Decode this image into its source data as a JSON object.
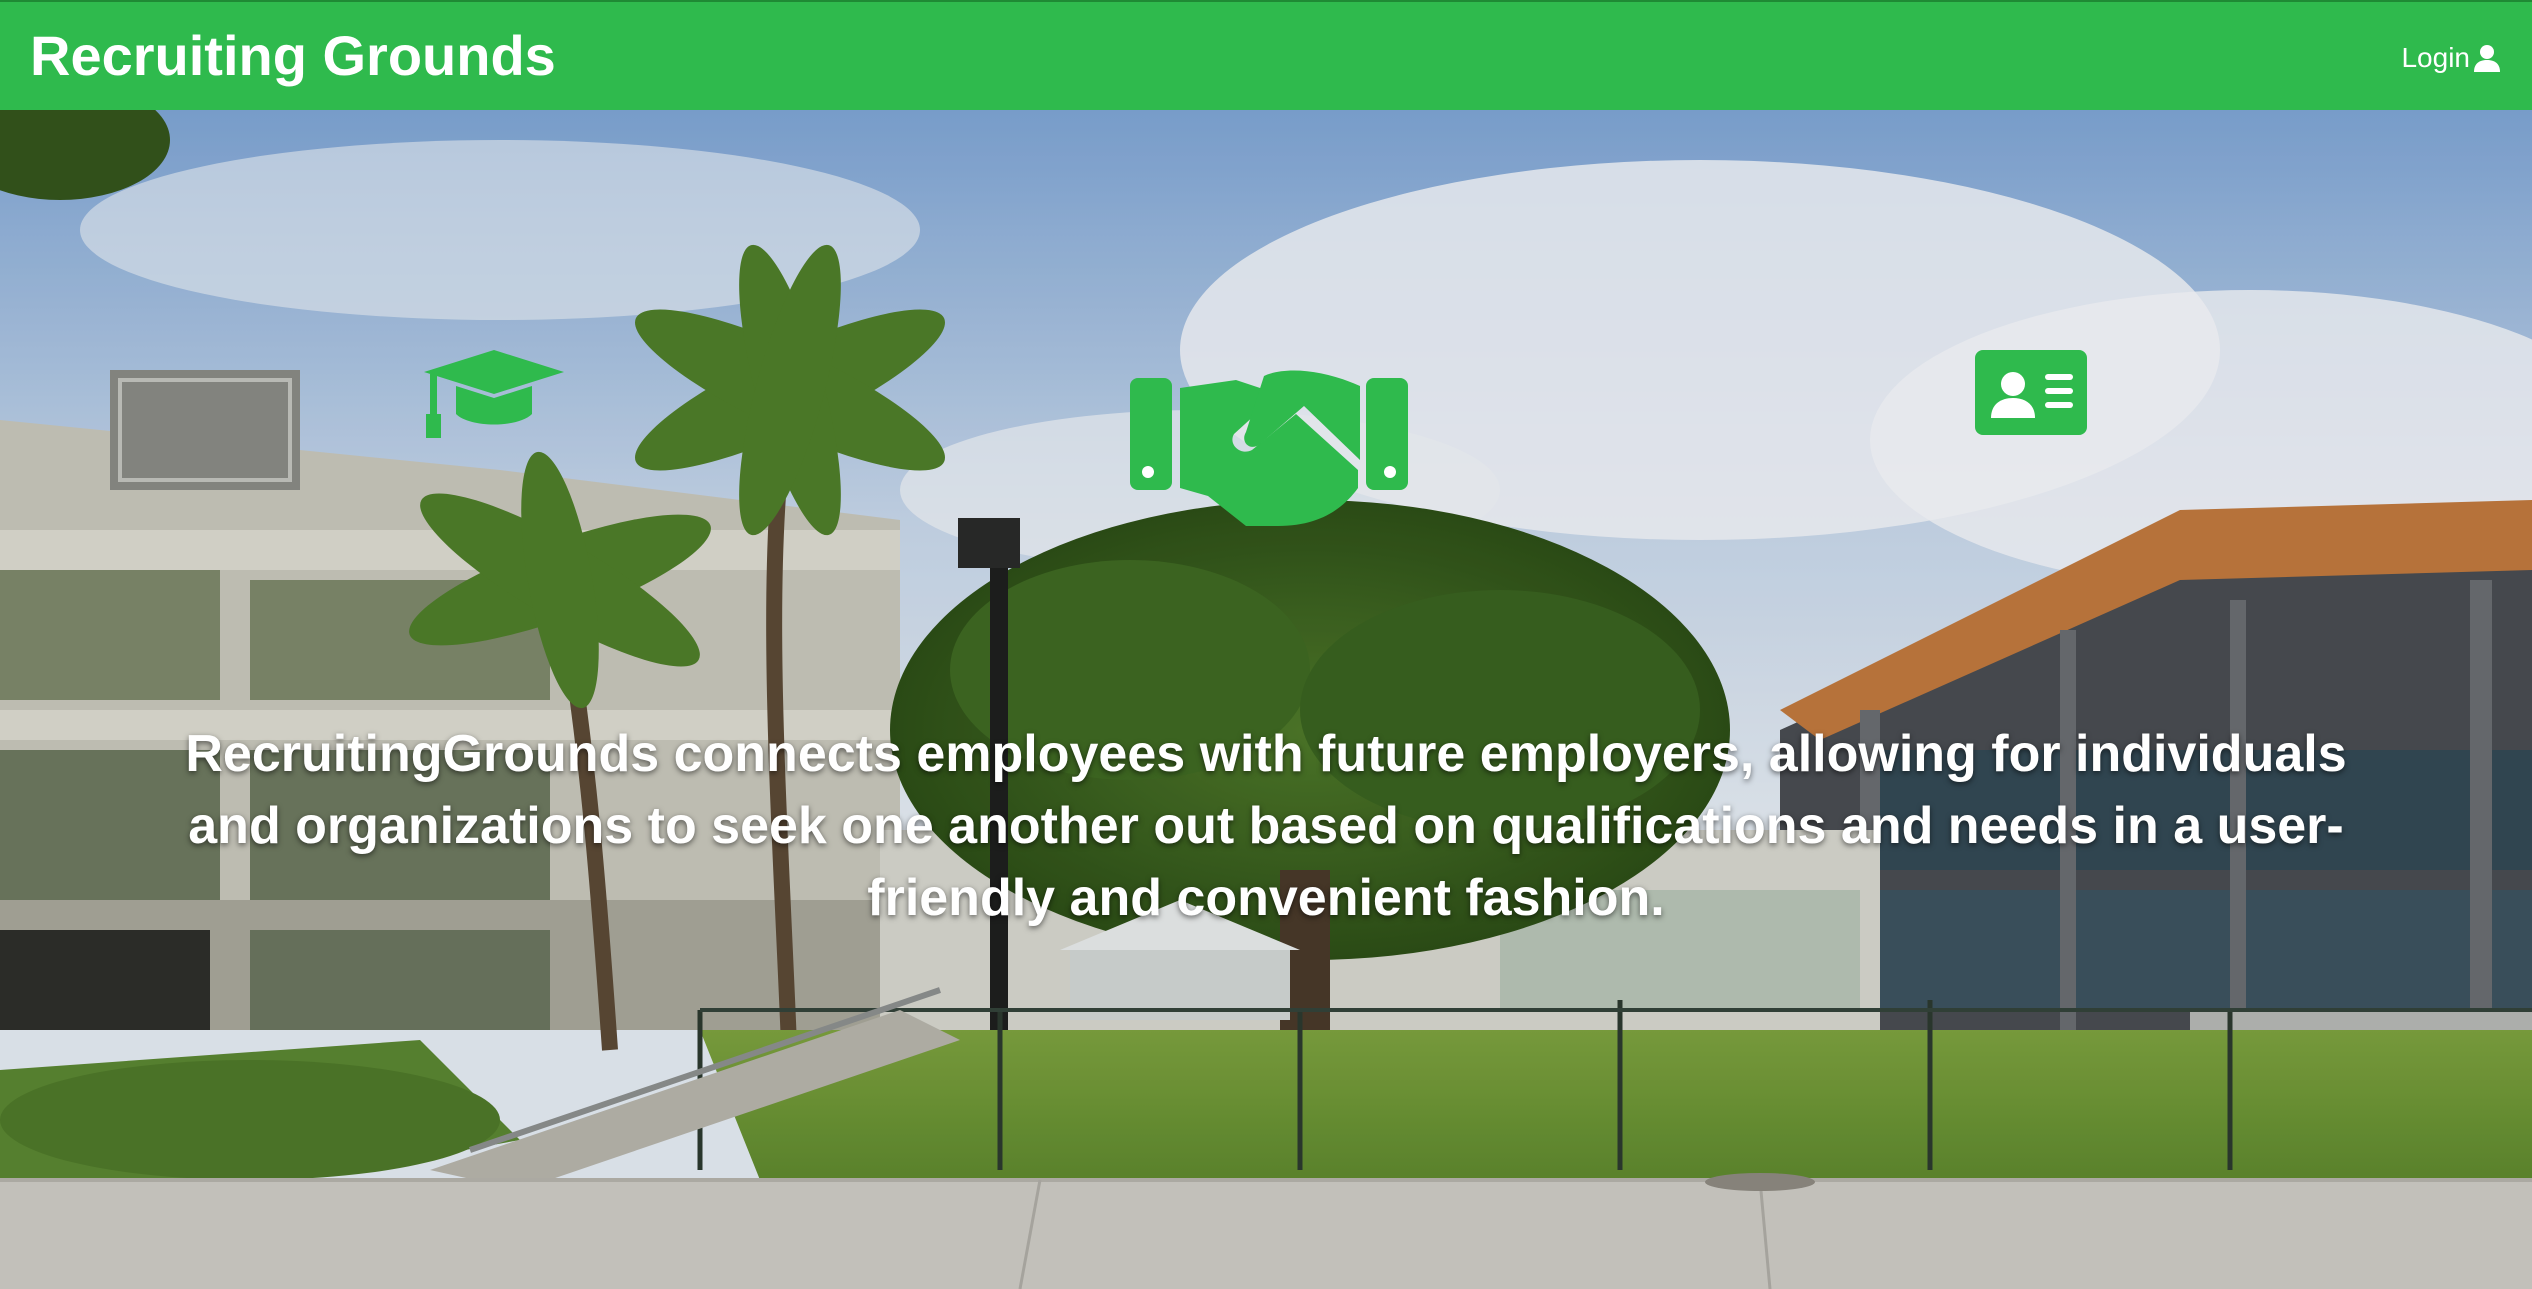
{
  "navbar": {
    "brand": "Recruiting Grounds",
    "login_label": "Login",
    "login_icon": "user-icon"
  },
  "hero": {
    "background": "campus-photo",
    "icons": [
      "graduation-cap-icon",
      "handshake-icon",
      "id-card-icon"
    ],
    "tagline": "RecruitingGrounds connects employees with future employers, allowing for individuals and organizations to seek one another out based on qualifications and needs in a user-friendly and convenient fashion."
  },
  "colors": {
    "brand_green": "#2fba4d",
    "text": "#ffffff"
  }
}
